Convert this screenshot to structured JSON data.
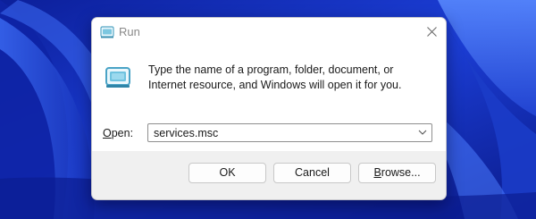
{
  "window": {
    "title": "Run",
    "icon": "run-icon",
    "close_icon": "close-icon"
  },
  "content": {
    "description": "Type the name of a program, folder, document, or Internet resource, and Windows will open it for you.",
    "open_label_accel": "O",
    "open_label_rest": "pen:",
    "open_value": "services.msc"
  },
  "buttons": {
    "ok": "OK",
    "cancel": "Cancel",
    "browse_accel": "B",
    "browse_rest": "rowse..."
  },
  "colors": {
    "wallpaper_primary": "#1a37c9",
    "wallpaper_light": "#4d7bff",
    "dialog_bg": "#f0f0f0",
    "content_bg": "#ffffff"
  }
}
